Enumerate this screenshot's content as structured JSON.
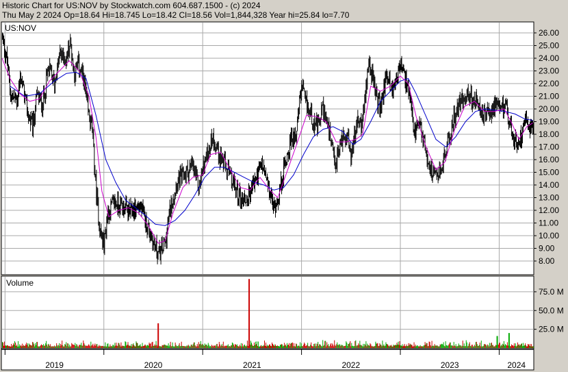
{
  "header": {
    "line1": "Historic Chart for US:NOV by Stockwatch.com 604.687.1500 - (c) 2024",
    "line2": "Thu May  2 2024   Op=18.64   Hi=18.745   Lo=18.42   Cl=18.56   Vol=1,844,328   Year hi=25.84   lo=7.70"
  },
  "colors": {
    "background": "#ffffff",
    "frame": "#d4d0c8",
    "price_bars": "#000000",
    "ma_short": "#cc00cc",
    "ma_long": "#0000cc",
    "volume_up": "#00aa00",
    "volume_down": "#cc0000"
  },
  "chart_data": {
    "type": "line",
    "title": "Historic Chart for US:NOV by Stockwatch.com 604.687.1500 - (c) 2024",
    "price_panel": {
      "label": "US:NOV",
      "ylim": [
        7,
        26.5
      ],
      "yticks": [
        "26.00",
        "25.00",
        "24.00",
        "23.00",
        "22.00",
        "21.00",
        "20.00",
        "19.00",
        "18.00",
        "17.00",
        "16.00",
        "15.00",
        "14.00",
        "13.00",
        "12.00",
        "11.00",
        "10.00",
        "9.00",
        "8.00"
      ],
      "grid": true
    },
    "volume_panel": {
      "label": "Volume",
      "ylim": [
        0,
        95
      ],
      "unit": "M",
      "yticks": [
        "75.0 M",
        "50.0 M",
        "25.0 M"
      ],
      "spikes": [
        {
          "t": 2020.55,
          "v": 33,
          "color": "down"
        },
        {
          "t": 2021.47,
          "v": 92,
          "color": "down"
        },
        {
          "t": 2023.98,
          "v": 16,
          "color": "up"
        },
        {
          "t": 2024.1,
          "v": 20,
          "color": "up"
        }
      ]
    },
    "x_labels": [
      "2019",
      "2020",
      "2021",
      "2022",
      "2023",
      "2024"
    ],
    "x_range": [
      2018.97,
      2024.35
    ],
    "price_anchors": [
      [
        2018.97,
        25.8
      ],
      [
        2019.02,
        23.8
      ],
      [
        2019.06,
        21.0
      ],
      [
        2019.12,
        20.7
      ],
      [
        2019.16,
        22.6
      ],
      [
        2019.22,
        20.0
      ],
      [
        2019.28,
        18.4
      ],
      [
        2019.32,
        21.0
      ],
      [
        2019.38,
        20.4
      ],
      [
        2019.44,
        23.2
      ],
      [
        2019.5,
        22.0
      ],
      [
        2019.56,
        24.4
      ],
      [
        2019.62,
        23.8
      ],
      [
        2019.66,
        25.3
      ],
      [
        2019.7,
        22.8
      ],
      [
        2019.74,
        23.6
      ],
      [
        2019.8,
        22.2
      ],
      [
        2019.84,
        19.8
      ],
      [
        2019.88,
        18.6
      ],
      [
        2019.92,
        13.8
      ],
      [
        2019.96,
        10.5
      ],
      [
        2020.0,
        9.2
      ],
      [
        2020.04,
        11.8
      ],
      [
        2020.1,
        12.6
      ],
      [
        2020.18,
        12.4
      ],
      [
        2020.26,
        11.8
      ],
      [
        2020.36,
        12.4
      ],
      [
        2020.44,
        10.8
      ],
      [
        2020.5,
        9.5
      ],
      [
        2020.56,
        8.5
      ],
      [
        2020.62,
        9.5
      ],
      [
        2020.68,
        12.5
      ],
      [
        2020.74,
        14.3
      ],
      [
        2020.82,
        14.9
      ],
      [
        2020.9,
        15.5
      ],
      [
        2020.96,
        13.8
      ],
      [
        2021.02,
        15.8
      ],
      [
        2021.1,
        17.8
      ],
      [
        2021.16,
        16.6
      ],
      [
        2021.22,
        15.6
      ],
      [
        2021.3,
        14.2
      ],
      [
        2021.38,
        13.0
      ],
      [
        2021.44,
        12.8
      ],
      [
        2021.52,
        14.2
      ],
      [
        2021.6,
        15.6
      ],
      [
        2021.68,
        13.3
      ],
      [
        2021.72,
        12.1
      ],
      [
        2021.78,
        13.5
      ],
      [
        2021.84,
        16.0
      ],
      [
        2021.9,
        17.6
      ],
      [
        2021.95,
        18.3
      ],
      [
        2022.0,
        21.8
      ],
      [
        2022.04,
        20.5
      ],
      [
        2022.1,
        19.5
      ],
      [
        2022.16,
        18.4
      ],
      [
        2022.22,
        20.2
      ],
      [
        2022.28,
        18.0
      ],
      [
        2022.34,
        15.4
      ],
      [
        2022.4,
        17.5
      ],
      [
        2022.46,
        18.2
      ],
      [
        2022.5,
        16.2
      ],
      [
        2022.56,
        18.8
      ],
      [
        2022.62,
        19.0
      ],
      [
        2022.68,
        24.0
      ],
      [
        2022.74,
        21.5
      ],
      [
        2022.8,
        20.0
      ],
      [
        2022.86,
        22.8
      ],
      [
        2022.92,
        21.4
      ],
      [
        2023.0,
        23.5
      ],
      [
        2023.08,
        21.5
      ],
      [
        2023.14,
        18.0
      ],
      [
        2023.2,
        18.6
      ],
      [
        2023.28,
        16.0
      ],
      [
        2023.34,
        14.6
      ],
      [
        2023.4,
        15.0
      ],
      [
        2023.46,
        16.6
      ],
      [
        2023.54,
        19.2
      ],
      [
        2023.62,
        20.8
      ],
      [
        2023.7,
        21.2
      ],
      [
        2023.78,
        20.2
      ],
      [
        2023.86,
        19.3
      ],
      [
        2023.94,
        20.2
      ],
      [
        2024.0,
        19.8
      ],
      [
        2024.06,
        20.6
      ],
      [
        2024.1,
        19.0
      ],
      [
        2024.16,
        17.2
      ],
      [
        2024.22,
        17.8
      ],
      [
        2024.27,
        19.8
      ],
      [
        2024.31,
        18.6
      ],
      [
        2024.34,
        18.56
      ]
    ],
    "ma_short_anchors": [
      [
        2018.97,
        24.0
      ],
      [
        2019.05,
        22.4
      ],
      [
        2019.15,
        21.2
      ],
      [
        2019.25,
        20.6
      ],
      [
        2019.35,
        20.8
      ],
      [
        2019.45,
        22.2
      ],
      [
        2019.55,
        23.0
      ],
      [
        2019.65,
        23.8
      ],
      [
        2019.75,
        23.0
      ],
      [
        2019.85,
        21.0
      ],
      [
        2019.92,
        17.8
      ],
      [
        2019.98,
        13.5
      ],
      [
        2020.05,
        11.5
      ],
      [
        2020.15,
        12.0
      ],
      [
        2020.25,
        12.2
      ],
      [
        2020.35,
        11.8
      ],
      [
        2020.45,
        10.8
      ],
      [
        2020.55,
        9.4
      ],
      [
        2020.62,
        9.6
      ],
      [
        2020.7,
        11.8
      ],
      [
        2020.8,
        13.8
      ],
      [
        2020.9,
        14.6
      ],
      [
        2021.0,
        14.8
      ],
      [
        2021.08,
        16.4
      ],
      [
        2021.18,
        16.6
      ],
      [
        2021.28,
        15.2
      ],
      [
        2021.38,
        13.8
      ],
      [
        2021.48,
        13.6
      ],
      [
        2021.58,
        14.6
      ],
      [
        2021.68,
        13.6
      ],
      [
        2021.76,
        13.0
      ],
      [
        2021.86,
        15.2
      ],
      [
        2021.96,
        17.4
      ],
      [
        2022.05,
        19.5
      ],
      [
        2022.15,
        19.4
      ],
      [
        2022.25,
        19.0
      ],
      [
        2022.35,
        17.4
      ],
      [
        2022.45,
        17.4
      ],
      [
        2022.55,
        17.6
      ],
      [
        2022.62,
        18.0
      ],
      [
        2022.7,
        21.8
      ],
      [
        2022.8,
        21.4
      ],
      [
        2022.9,
        21.8
      ],
      [
        2023.0,
        22.6
      ],
      [
        2023.08,
        22.0
      ],
      [
        2023.16,
        19.4
      ],
      [
        2023.26,
        17.0
      ],
      [
        2023.36,
        15.2
      ],
      [
        2023.45,
        15.8
      ],
      [
        2023.55,
        18.4
      ],
      [
        2023.65,
        20.2
      ],
      [
        2023.75,
        20.6
      ],
      [
        2023.85,
        19.8
      ],
      [
        2023.95,
        19.8
      ],
      [
        2024.05,
        20.0
      ],
      [
        2024.12,
        19.0
      ],
      [
        2024.2,
        17.6
      ],
      [
        2024.28,
        18.6
      ],
      [
        2024.34,
        18.9
      ]
    ],
    "ma_long_anchors": [
      [
        2019.05,
        21.8
      ],
      [
        2019.2,
        21.0
      ],
      [
        2019.35,
        21.2
      ],
      [
        2019.5,
        22.2
      ],
      [
        2019.62,
        22.8
      ],
      [
        2019.72,
        22.9
      ],
      [
        2019.82,
        22.4
      ],
      [
        2019.92,
        19.5
      ],
      [
        2020.02,
        16.0
      ],
      [
        2020.12,
        14.2
      ],
      [
        2020.22,
        12.8
      ],
      [
        2020.32,
        12.2
      ],
      [
        2020.42,
        11.6
      ],
      [
        2020.52,
        10.9
      ],
      [
        2020.62,
        10.8
      ],
      [
        2020.72,
        11.2
      ],
      [
        2020.82,
        12.0
      ],
      [
        2020.92,
        13.2
      ],
      [
        2021.02,
        14.6
      ],
      [
        2021.12,
        15.4
      ],
      [
        2021.22,
        15.4
      ],
      [
        2021.32,
        15.0
      ],
      [
        2021.42,
        14.6
      ],
      [
        2021.52,
        14.2
      ],
      [
        2021.62,
        14.0
      ],
      [
        2021.72,
        13.6
      ],
      [
        2021.82,
        13.8
      ],
      [
        2021.92,
        14.8
      ],
      [
        2022.02,
        16.4
      ],
      [
        2022.12,
        17.8
      ],
      [
        2022.22,
        18.4
      ],
      [
        2022.32,
        18.6
      ],
      [
        2022.42,
        18.2
      ],
      [
        2022.52,
        17.2
      ],
      [
        2022.6,
        17.6
      ],
      [
        2022.7,
        19.0
      ],
      [
        2022.8,
        20.6
      ],
      [
        2022.9,
        21.4
      ],
      [
        2023.0,
        22.2
      ],
      [
        2023.08,
        22.4
      ],
      [
        2023.16,
        21.2
      ],
      [
        2023.26,
        19.4
      ],
      [
        2023.36,
        17.6
      ],
      [
        2023.46,
        17.0
      ],
      [
        2023.56,
        17.8
      ],
      [
        2023.66,
        19.0
      ],
      [
        2023.76,
        19.8
      ],
      [
        2023.86,
        20.0
      ],
      [
        2023.96,
        19.9
      ],
      [
        2024.06,
        19.8
      ],
      [
        2024.16,
        19.6
      ],
      [
        2024.26,
        19.2
      ],
      [
        2024.34,
        19.1
      ]
    ]
  }
}
